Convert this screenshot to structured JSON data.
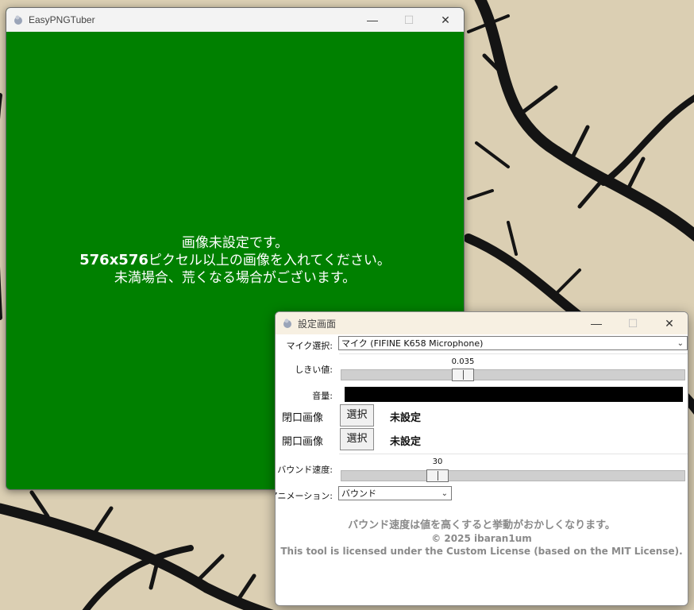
{
  "main_window": {
    "title": "EasyPNGTuber",
    "message": {
      "line1": "画像未設定です。",
      "line2_size": "576x576",
      "line2_text": "ピクセル以上の画像を入れてください。",
      "line3": "未満場合、荒くなる場合がございます。"
    },
    "background_color": "#008000"
  },
  "settings_window": {
    "title": "設定画面",
    "mic": {
      "label": "マイク選択:",
      "value": "マイク (FIFINE K658 Microphone)"
    },
    "threshold": {
      "label": "しきい値:",
      "value_text": "0.035"
    },
    "volume": {
      "label": "音量:"
    },
    "image1": {
      "label": "閉口画像",
      "button": "選択",
      "status": "未設定"
    },
    "image2": {
      "label": "開口画像",
      "button": "選択",
      "status": "未設定"
    },
    "bounce": {
      "label": "バウンド速度:",
      "value_text": "30"
    },
    "animation": {
      "label": "アニメーション:",
      "value": "バウンド"
    },
    "footer": {
      "warning": "バウンド速度は値を高くすると挙動がおかしくなります。",
      "copyright": "© 2025 ibaran1um",
      "license": "This tool is licensed under the Custom License (based on the MIT License)."
    }
  },
  "icons": {
    "minimize": "minimize-icon",
    "maximize": "maximize-icon",
    "close": "close-icon",
    "chevron": "chevron-down-icon",
    "app": "app-icon"
  },
  "titlebar_controls": {
    "minimize": "—",
    "maximize": "☐",
    "close": "✕",
    "chevron": "⌄"
  }
}
